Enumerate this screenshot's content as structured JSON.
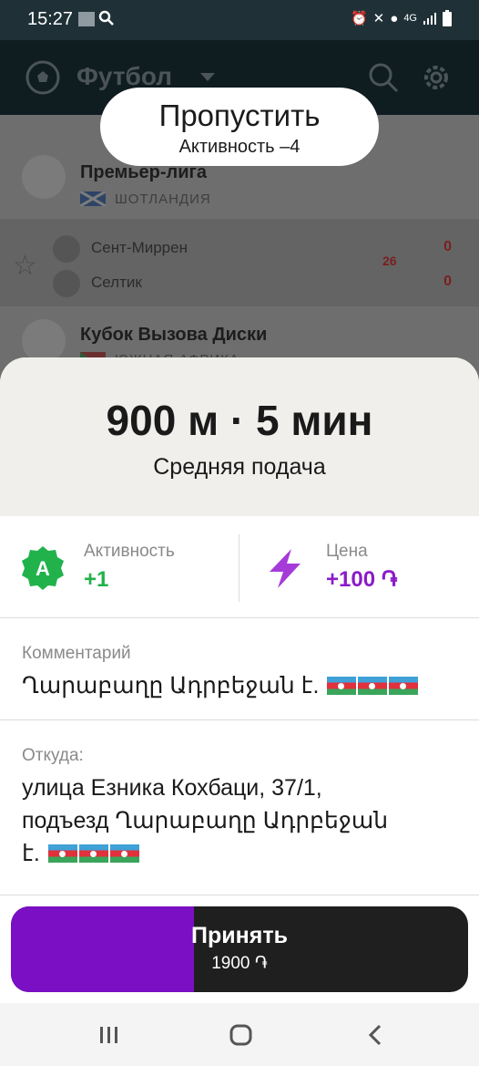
{
  "status_bar": {
    "time": "15:27",
    "network": "4G"
  },
  "app_bar": {
    "title": "Футбол"
  },
  "background_list": {
    "league1": {
      "name": "Премьер-лига",
      "country": "ШОТЛАНДИЯ"
    },
    "match": {
      "home": {
        "name": "Сент-Миррен",
        "score": "0"
      },
      "away": {
        "name": "Селтик",
        "score": "0"
      },
      "minute": "26"
    },
    "league2": {
      "name": "Кубок Вызова Диски",
      "country": "ЮЖНАЯ АФРИКА"
    }
  },
  "skip": {
    "label": "Пропустить",
    "activity": "Активность –4"
  },
  "order": {
    "headline": "900 м · 5 мин",
    "subtitle": "Средняя подача",
    "activity_label": "Активность",
    "activity_value": "+1",
    "activity_badge": "A",
    "price_label": "Цена",
    "price_value": "+100 ֏",
    "comment_label": "Комментарий",
    "comment_text": "Ղարաբաղը Ադրբեջան է.",
    "from_label": "Откуда:",
    "from_line1": "улица Езника Кохбаци, 37/1,",
    "from_line2": "подъезд Ղարաբաղը Ադրբեջան",
    "from_line3": "է."
  },
  "accept": {
    "label": "Принять",
    "price": "1900 ֏",
    "progress_fraction": 0.4
  },
  "colors": {
    "accent_purple": "#7a0fc4",
    "activity_green": "#21b24b",
    "price_purple": "#8a1cc9"
  }
}
